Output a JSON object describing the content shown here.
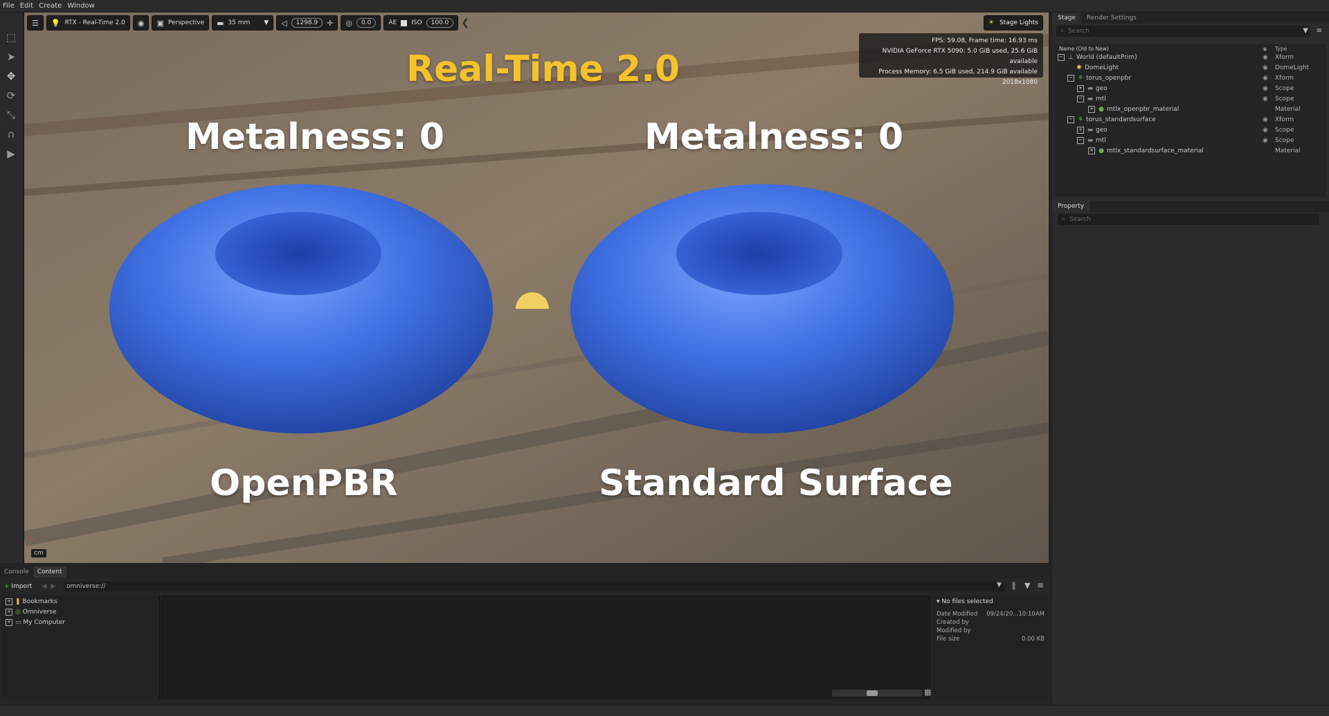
{
  "menu": [
    "File",
    "Edit",
    "Create",
    "Window"
  ],
  "viewport_toolbar": {
    "renderer": "RTX - Real-Time 2.0",
    "camera": "Perspective",
    "focal_length": "35 mm",
    "focal_distance": "1298.9",
    "exposure": "0.0",
    "ae_label": "AE",
    "iso_label": "ISO",
    "iso_value": "100.0",
    "stage_lights": "Stage Lights"
  },
  "stats": {
    "fps": "FPS: 59.08, Frame time: 16.93 ms",
    "gpu": "NVIDIA GeForce RTX 5090: 5.0 GiB used, 25.6 GiB available",
    "memory": "Process Memory: 6.5 GiB used, 214.9 GiB available",
    "resolution": "2018x1080"
  },
  "viewport_scene": {
    "title": "Real-Time 2.0",
    "left_metal": "Metalness: 0",
    "right_metal": "Metalness: 0",
    "left_label": "OpenPBR",
    "right_label": "Standard Surface",
    "unit": "cm"
  },
  "colors": {
    "title": "#f4c22b",
    "torus": "#3b6ee0",
    "accent_green": "#6ab04c"
  },
  "right_panel": {
    "tabs": [
      "Stage",
      "Render Settings"
    ],
    "search_placeholder": "Search",
    "col_name": "Name (Old to New)",
    "col_type": "Type",
    "tree": [
      {
        "name": "World (defaultPrim)",
        "type": "Xform",
        "icon": "xform-icon"
      },
      {
        "name": "DomeLight",
        "type": "DomeLight",
        "icon": "light-icon"
      },
      {
        "name": "torus_openpbr",
        "type": "Xform",
        "icon": "xform-icon"
      },
      {
        "name": "geo",
        "type": "Scope",
        "icon": "folder-icon"
      },
      {
        "name": "mtl",
        "type": "Scope",
        "icon": "folder-icon"
      },
      {
        "name": "mtlx_openpbr_material",
        "type": "Material",
        "icon": "material-icon"
      },
      {
        "name": "torus_standardsurface",
        "type": "Xform",
        "icon": "xform-icon"
      },
      {
        "name": "geo",
        "type": "Scope",
        "icon": "folder-icon"
      },
      {
        "name": "mtl",
        "type": "Scope",
        "icon": "folder-icon"
      },
      {
        "name": "mtlx_standardsurface_material",
        "type": "Material",
        "icon": "material-icon"
      }
    ],
    "property_tab": "Property",
    "property_search": "Search"
  },
  "bottom_panel": {
    "tabs": [
      "Console",
      "Content"
    ],
    "import": "Import",
    "path": "omniverse://",
    "bookmarks": [
      "Bookmarks",
      "Omniverse",
      "My Computer"
    ],
    "details_header": "No files selected",
    "details": [
      {
        "label": "Date Modified",
        "value": "09/24/20...10:10AM"
      },
      {
        "label": "Created by",
        "value": ""
      },
      {
        "label": "Modified by",
        "value": ""
      },
      {
        "label": "File size",
        "value": "0.00 KB"
      }
    ]
  }
}
